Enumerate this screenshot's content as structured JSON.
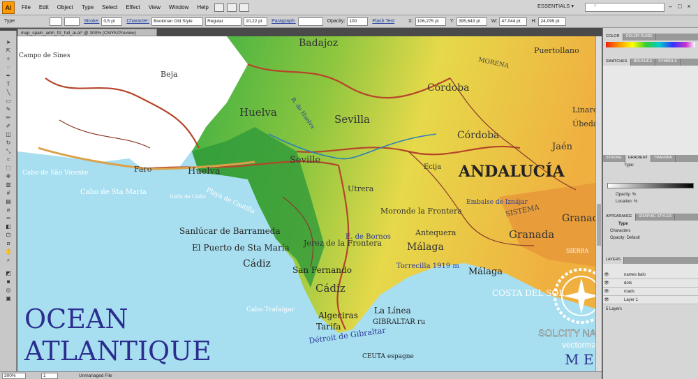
{
  "app": {
    "logo": "Ai",
    "essentials": "ESSENTIALS ▾"
  },
  "menu": [
    "File",
    "Edit",
    "Object",
    "Type",
    "Select",
    "Effect",
    "View",
    "Window",
    "Help"
  ],
  "control_bar": {
    "type_label": "Type",
    "stroke_label": "Stroke:",
    "stroke_value": "0,5 pt",
    "character_label": "Character:",
    "font_family": "Bookman Old Style",
    "font_style": "Regular",
    "font_size": "10,22 pt",
    "paragraph_label": "Paragraph:",
    "opacity_label": "Opacity:",
    "opacity_value": "100",
    "flash_text": "Flash Text",
    "x_label": "X:",
    "x_value": "106,275 pt",
    "y_label": "Y:",
    "y_value": "395,643 pt",
    "w_label": "W:",
    "w_value": "47,044 pt",
    "h_label": "H:",
    "h_value": "24,099 pt"
  },
  "document_tab": "map_spain_adm_fiz_full_ai.ai* @ 300% (CMYK/Preview)",
  "status_bar": {
    "zoom": "300%",
    "page": "1",
    "info": "Unmanaged File"
  },
  "panels": {
    "color_tabs": [
      "COLOR",
      "COLOR GUIDE"
    ],
    "swatch_tabs": [
      "SWATCHES",
      "BRUSHES",
      "SYMBOLS"
    ],
    "stroke_tabs": [
      "STROKE",
      "GRADIENT",
      "TRANSPA"
    ],
    "gradient_type_label": "Type:",
    "opacity_label": "Opacity:",
    "location_label": "Location:",
    "percent": "%",
    "appearance_tabs": [
      "APPEARANCE",
      "GRAPHIC STYLES"
    ],
    "appearance_type": "Type",
    "appearance_characters": "Characters",
    "appearance_opacity": "Opacity:",
    "appearance_opacity_value": "Default",
    "layers_tab": "LAYERS",
    "layers": [
      {
        "name": "names balo"
      },
      {
        "name": "dots"
      },
      {
        "name": "roads"
      },
      {
        "name": "Layer 1"
      }
    ],
    "layers_count": "5 Layers"
  },
  "map": {
    "cities": [
      "Badajoz",
      "Puertollano",
      "Beja",
      "Córdoba",
      "Huelva",
      "Sevilla",
      "Linares",
      "Úbeda",
      "Córdoba",
      "Jaén",
      "Faro",
      "Huelva",
      "Seville",
      "Ecija",
      "ANDALUCÍA",
      "Utrera",
      "Moronde la Frontera",
      "Antequera",
      "Granada",
      "Granada",
      "Sanlúcar de Barrameda",
      "El Puerto de Sta María",
      "Jerez de la Frontera",
      "Cádiz",
      "San Fernando",
      "Málaga",
      "Málaga",
      "Cádiz",
      "Algeciras",
      "La Línea",
      "Tarifa",
      "GIBRALTAR ru",
      "CEUTA espagne"
    ],
    "features": [
      "Cabo de São Vicente",
      "Cabo de Sta Maria",
      "Golfo de Cádiz",
      "Playa de Castilla",
      "Cabo Trafalgar",
      "Détroit de Gibraltar",
      "Embalse de Iznájar",
      "E. de Bornos",
      "Torrecilla 1919 m",
      "MORENA",
      "SISTEMA",
      "SIERRA",
      "COSTA DEL SOL",
      "Campo de Sines",
      "R. de Huelva"
    ],
    "ocean_line1": "OCEAN",
    "ocean_line2": "ATLANTIQUE",
    "sea": "M E",
    "watermark_title": "SOLCITY NAVEGACIÓN",
    "watermark_url": "vectormap.info"
  }
}
